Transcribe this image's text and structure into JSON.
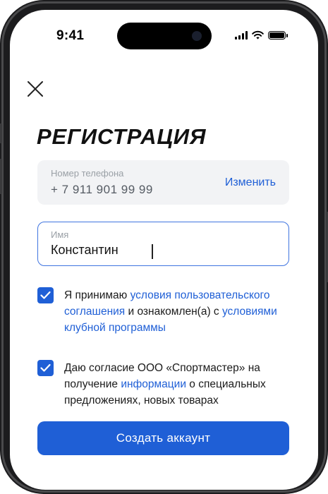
{
  "status_bar": {
    "time": "9:41"
  },
  "header": {
    "title": "РЕГИСТРАЦИЯ"
  },
  "phone_field": {
    "label": "Номер телефона",
    "value": "+ 7 911 901 99 99",
    "change_link": "Изменить"
  },
  "name_field": {
    "label": "Имя",
    "value": "Константин"
  },
  "consents": [
    {
      "checked": true,
      "parts": [
        "Я принимаю ",
        "условия пользовательского соглашения",
        " и ознакомлен(а) с ",
        "условиями клубной программы"
      ]
    },
    {
      "checked": true,
      "parts": [
        "Даю согласие ООО «Спортмастер» на получение ",
        "информации",
        " о специальных предложениях, новых товарах"
      ]
    }
  ],
  "submit": {
    "label": "Создать аккаунт"
  },
  "colors": {
    "accent": "#1f5fd6",
    "field_bg": "#f2f3f5",
    "title": "#111111"
  }
}
